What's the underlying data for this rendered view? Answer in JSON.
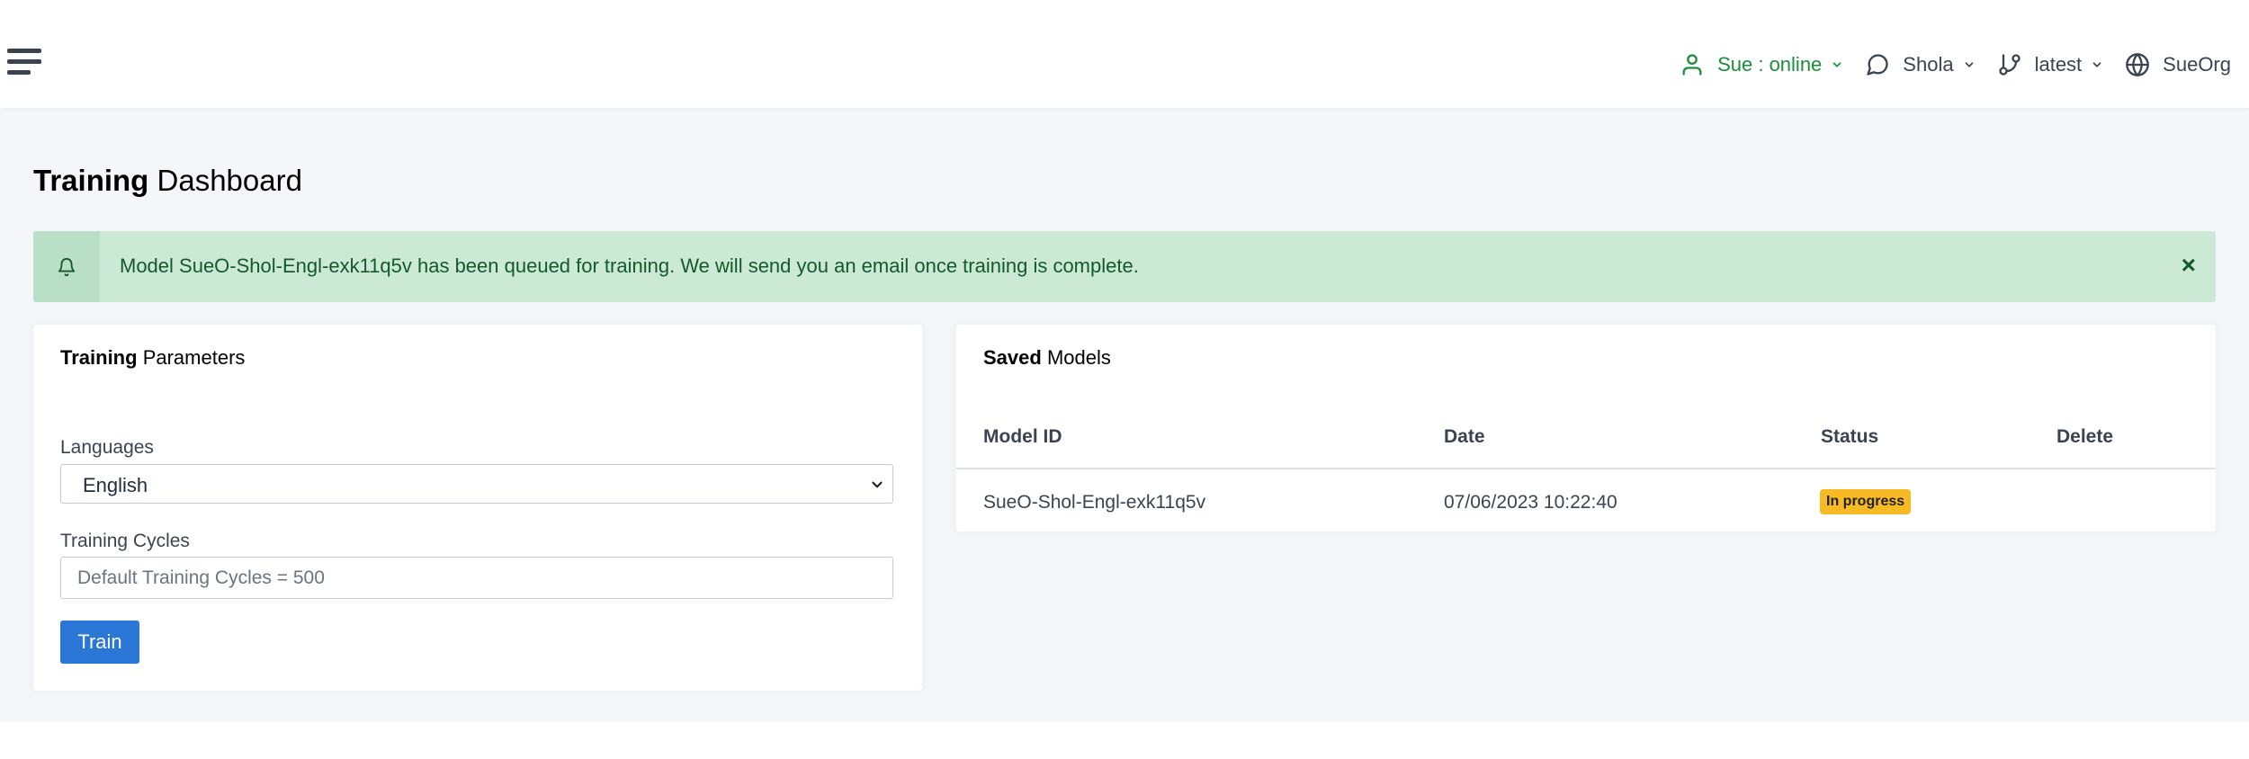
{
  "topbar": {
    "user_status": "Sue : online",
    "chat_name": "Shola",
    "branch": "latest",
    "org": "SueOrg"
  },
  "page": {
    "title_bold": "Training",
    "title_rest": "Dashboard"
  },
  "alert": {
    "message": "Model SueO-Shol-Engl-exk11q5v has been queued for training. We will send you an email once training is complete.",
    "close_label": "×"
  },
  "training_params": {
    "title_bold": "Training",
    "title_rest": "Parameters",
    "languages_label": "Languages",
    "language_selected": "English",
    "cycles_label": "Training Cycles",
    "cycles_placeholder": "Default Training Cycles = 500",
    "cycles_value": "",
    "train_button": "Train"
  },
  "saved_models": {
    "title_bold": "Saved",
    "title_rest": "Models",
    "columns": [
      "Model ID",
      "Date",
      "Status",
      "Delete"
    ],
    "rows": [
      {
        "model_id": "SueO-Shol-Engl-exk11q5v",
        "date": "07/06/2023 10:22:40",
        "status": "In progress",
        "delete": ""
      }
    ]
  },
  "colors": {
    "online_green": "#1b8e3c",
    "alert_bg": "#cce9d6",
    "primary_blue": "#2b77d8",
    "badge_yellow": "#f7b924"
  },
  "icons": {
    "menu": "hamburger-icon",
    "user": "user-icon",
    "chat": "chat-bubble-icon",
    "branch": "git-branch-icon",
    "org": "globe-icon",
    "alert": "bell-icon"
  }
}
